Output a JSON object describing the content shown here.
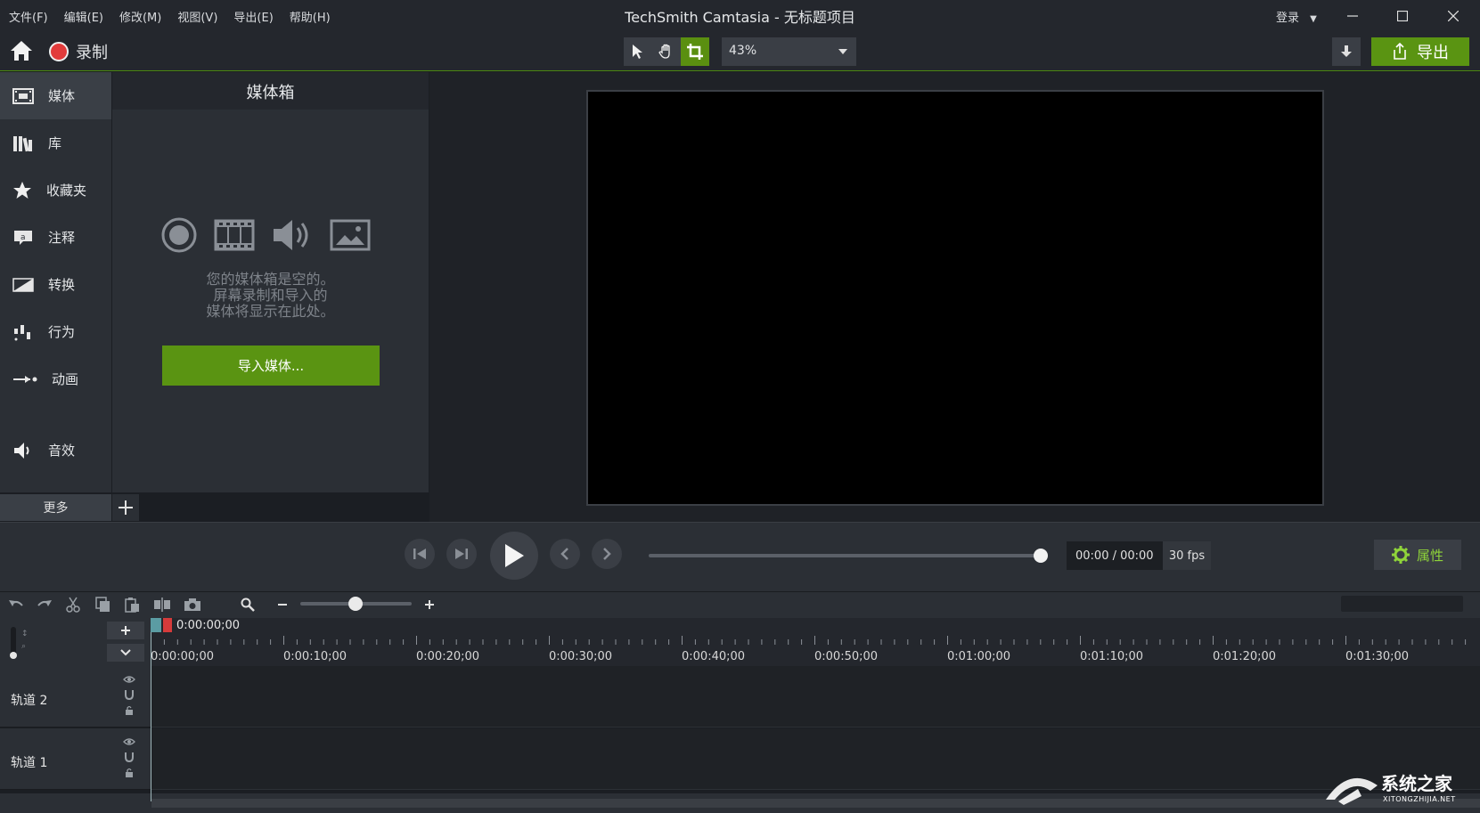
{
  "window": {
    "title": "TechSmith Camtasia - 无标题项目",
    "menu": [
      "文件(F)",
      "编辑(E)",
      "修改(M)",
      "视图(V)",
      "导出(E)",
      "帮助(H)"
    ],
    "login_label": "登录"
  },
  "toolbar": {
    "record_label": "录制",
    "zoom_value": "43%",
    "export_label": "导出",
    "icons": [
      "home-icon",
      "record-icon",
      "pointer-icon",
      "hand-icon",
      "crop-icon",
      "download-icon",
      "share-icon"
    ]
  },
  "sidebar": {
    "items": [
      {
        "label": "媒体",
        "icon": "film-icon",
        "active": true
      },
      {
        "label": "库",
        "icon": "library-icon",
        "active": false
      },
      {
        "label": "收藏夹",
        "icon": "star-icon",
        "active": false
      },
      {
        "label": "注释",
        "icon": "annotation-icon",
        "active": false
      },
      {
        "label": "转换",
        "icon": "transition-icon",
        "active": false
      },
      {
        "label": "行为",
        "icon": "behavior-icon",
        "active": false
      },
      {
        "label": "动画",
        "icon": "animation-icon",
        "active": false
      },
      {
        "label": "音效",
        "icon": "audio-icon",
        "active": false
      }
    ],
    "more_label": "更多"
  },
  "media_bin": {
    "title": "媒体箱",
    "empty_line1": "您的媒体箱是空的。",
    "empty_line2": "屏幕录制和导入的",
    "empty_line3": "媒体将显示在此处。",
    "import_label": "导入媒体..."
  },
  "playback": {
    "time": "00:00 / 00:00",
    "fps": "30 fps",
    "properties_label": "属性"
  },
  "timeline": {
    "playhead_time": "0:00:00;00",
    "ruler_labels": [
      "0:00:00;00",
      "0:00:10;00",
      "0:00:20;00",
      "0:00:30;00",
      "0:00:40;00",
      "0:00:50;00",
      "0:01:00;00",
      "0:01:10;00",
      "0:01:20;00",
      "0:01:30;00"
    ],
    "tracks": [
      {
        "label": "轨道 2"
      },
      {
        "label": "轨道 1"
      }
    ]
  },
  "watermark": {
    "text_cn": "系统之家",
    "text_en": "XITONGZHIJIA.NET"
  },
  "colors": {
    "accent_green": "#5a9412",
    "record_red": "#e23b3b",
    "properties_text": "#8fd43a"
  }
}
